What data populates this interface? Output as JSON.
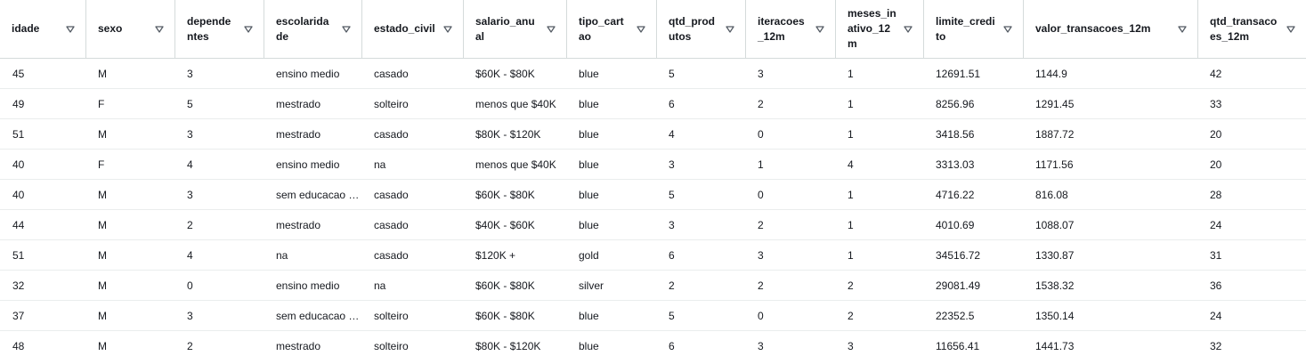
{
  "columns": [
    {
      "key": "idade",
      "label": "idade"
    },
    {
      "key": "sexo",
      "label": "sexo"
    },
    {
      "key": "dependentes",
      "label": "dependentes"
    },
    {
      "key": "escolaridade",
      "label": "escolaridade"
    },
    {
      "key": "estado_civil",
      "label": "estado_civil"
    },
    {
      "key": "salario_anual",
      "label": "salario_anual"
    },
    {
      "key": "tipo_cartao",
      "label": "tipo_cartao"
    },
    {
      "key": "qtd_produtos",
      "label": "qtd_produtos"
    },
    {
      "key": "iteracoes_12m",
      "label": "iteracoes_12m"
    },
    {
      "key": "meses_inativo_12m",
      "label": "meses_inativo_12m"
    },
    {
      "key": "limite_credito",
      "label": "limite_credito"
    },
    {
      "key": "valor_transacoes_12m",
      "label": "valor_transacoes_12m"
    },
    {
      "key": "qtd_transacoes_12m",
      "label": "qtd_transacoes_12m"
    }
  ],
  "sort_icon": "sort-triangle-down-icon",
  "rows": [
    [
      "45",
      "M",
      "3",
      "ensino medio",
      "casado",
      "$60K - $80K",
      "blue",
      "5",
      "3",
      "1",
      "12691.51",
      "1144.9",
      "42"
    ],
    [
      "49",
      "F",
      "5",
      "mestrado",
      "solteiro",
      "menos que $40K",
      "blue",
      "6",
      "2",
      "1",
      "8256.96",
      "1291.45",
      "33"
    ],
    [
      "51",
      "M",
      "3",
      "mestrado",
      "casado",
      "$80K - $120K",
      "blue",
      "4",
      "0",
      "1",
      "3418.56",
      "1887.72",
      "20"
    ],
    [
      "40",
      "F",
      "4",
      "ensino medio",
      "na",
      "menos que $40K",
      "blue",
      "3",
      "1",
      "4",
      "3313.03",
      "1171.56",
      "20"
    ],
    [
      "40",
      "M",
      "3",
      "sem educacao formal",
      "casado",
      "$60K - $80K",
      "blue",
      "5",
      "0",
      "1",
      "4716.22",
      "816.08",
      "28"
    ],
    [
      "44",
      "M",
      "2",
      "mestrado",
      "casado",
      "$40K - $60K",
      "blue",
      "3",
      "2",
      "1",
      "4010.69",
      "1088.07",
      "24"
    ],
    [
      "51",
      "M",
      "4",
      "na",
      "casado",
      "$120K +",
      "gold",
      "6",
      "3",
      "1",
      "34516.72",
      "1330.87",
      "31"
    ],
    [
      "32",
      "M",
      "0",
      "ensino medio",
      "na",
      "$60K - $80K",
      "silver",
      "2",
      "2",
      "2",
      "29081.49",
      "1538.32",
      "36"
    ],
    [
      "37",
      "M",
      "3",
      "sem educacao formal",
      "solteiro",
      "$60K - $80K",
      "blue",
      "5",
      "0",
      "2",
      "22352.5",
      "1350.14",
      "24"
    ],
    [
      "48",
      "M",
      "2",
      "mestrado",
      "solteiro",
      "$80K - $120K",
      "blue",
      "6",
      "3",
      "3",
      "11656.41",
      "1441.73",
      "32"
    ]
  ]
}
